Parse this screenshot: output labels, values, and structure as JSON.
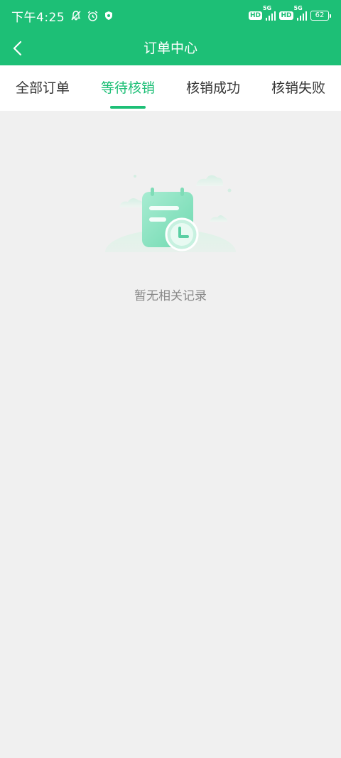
{
  "status_bar": {
    "time": "下午4:25",
    "network_1": "5G",
    "network_2": "5G",
    "hd_label": "HD",
    "battery": "62"
  },
  "header": {
    "title": "订单中心"
  },
  "tabs": [
    {
      "label": "全部订单",
      "active": false
    },
    {
      "label": "等待核销",
      "active": true
    },
    {
      "label": "核销成功",
      "active": false
    },
    {
      "label": "核销失败",
      "active": false
    }
  ],
  "empty_state": {
    "message": "暂无相关记录"
  },
  "colors": {
    "brand": "#1dbf76",
    "background": "#f0f0f0"
  },
  "icons": [
    "back-arrow-icon",
    "bell-off-icon",
    "alarm-icon",
    "shield-icon",
    "signal-icon",
    "battery-icon",
    "empty-calendar-clock-icon"
  ]
}
